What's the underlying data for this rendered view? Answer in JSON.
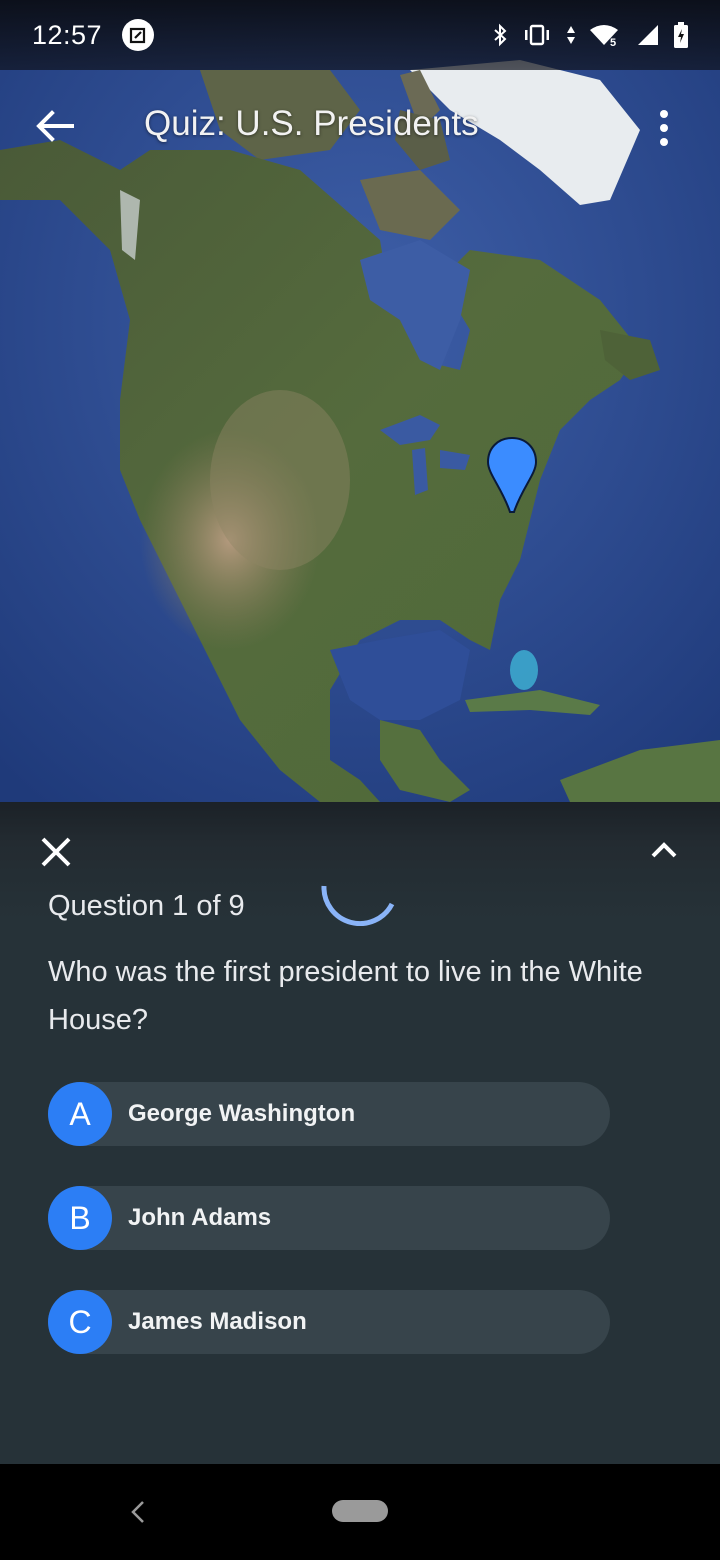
{
  "status_bar": {
    "time": "12:57",
    "notification_icon": "screenshot-edit-icon",
    "icons": [
      "bluetooth-icon",
      "vibrate-icon",
      "data-arrows-icon",
      "wifi-icon",
      "signal-icon",
      "battery-charging-icon"
    ],
    "wifi_badge": "5"
  },
  "app_bar": {
    "title": "Quiz: U.S. Presidents",
    "back_icon": "arrow-back-icon",
    "menu_icon": "more-vert-icon"
  },
  "map": {
    "pin_color": "#3b8cff",
    "region": "North America"
  },
  "quiz": {
    "counter": "Question 1 of 9",
    "question": "Who was the first president to live in the White House?",
    "answers": [
      {
        "letter": "A",
        "label": "George Washington"
      },
      {
        "letter": "B",
        "label": "John Adams"
      },
      {
        "letter": "C",
        "label": "James Madison"
      }
    ],
    "accent_color": "#2c7ef5"
  },
  "nav_bar": {
    "back_icon": "nav-back-icon",
    "home_icon": "home-pill-icon"
  }
}
